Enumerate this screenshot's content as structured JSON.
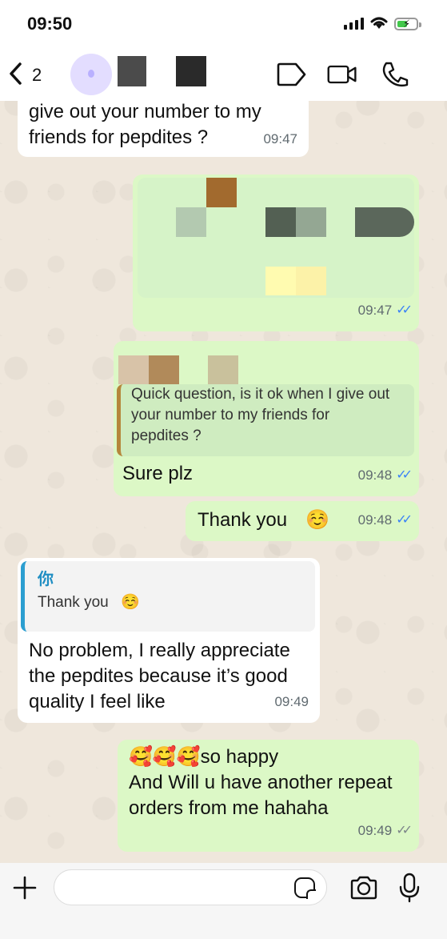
{
  "status_bar": {
    "time": "09:50"
  },
  "header": {
    "back_count": "2"
  },
  "messages": {
    "m1_partial": {
      "lines": [
        "give out your number to my",
        "friends for pepdites ?"
      ],
      "time": "09:47"
    },
    "m2_image": {
      "time": "09:47"
    },
    "m3": {
      "quote_text": [
        "Quick question, is it ok when I give out",
        "your number to my friends for",
        "pepdites ?"
      ],
      "text": "Sure plz",
      "time": "09:48"
    },
    "m4": {
      "text": "Thank you",
      "emoji": "☺️",
      "time": "09:48"
    },
    "m5": {
      "quote_author": "你",
      "quote_text": "Thank you",
      "quote_emoji": "☺️",
      "lines": [
        "No problem, I really appreciate",
        "the pepdites because it’s good",
        "quality I feel like"
      ],
      "time": "09:49"
    },
    "m6": {
      "emojis": "🥰🥰🥰",
      "lines": [
        "so happy",
        "And Will u have another repeat",
        "orders from me hahaha"
      ],
      "time": "09:49"
    }
  },
  "input": {
    "placeholder": ""
  },
  "icons": [
    "back-chevron-icon",
    "tag-icon",
    "video-camera-icon",
    "phone-icon",
    "plus-icon",
    "sticker-icon",
    "camera-icon",
    "microphone-icon"
  ],
  "colors": {
    "outgoing": "#dcf8c6",
    "incoming": "#ffffff",
    "read_ticks": "#3b82f6",
    "quote_bar": "#2b9ed0"
  }
}
